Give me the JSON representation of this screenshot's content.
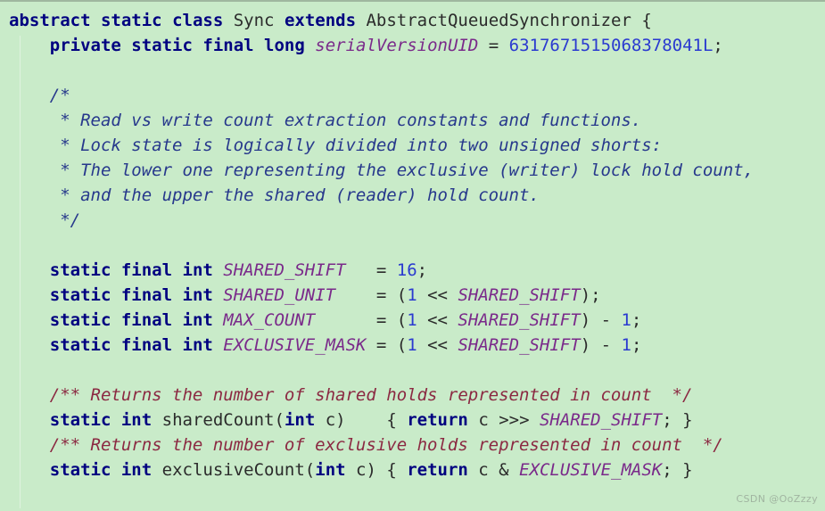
{
  "editor": {
    "language": "java",
    "background_color": "#c9ebc9",
    "top_border_color": "#9fb79f",
    "indent_guide_color": "#dff2df",
    "theme_colors": {
      "keyword": "#000080",
      "identifier": "#2b2b2b",
      "constant": "#7a2a8a",
      "number": "#2a3ad0",
      "block_comment": "#27388c",
      "javadoc_comment": "#8b2942"
    }
  },
  "watermark": {
    "text": "CSDN @OoZzzy"
  },
  "lines": [
    {
      "id": 1,
      "tokens": [
        {
          "t": "abstract",
          "k": "kw"
        },
        {
          "t": " ",
          "k": "punc"
        },
        {
          "t": "static",
          "k": "kw"
        },
        {
          "t": " ",
          "k": "punc"
        },
        {
          "t": "class",
          "k": "kw"
        },
        {
          "t": " ",
          "k": "punc"
        },
        {
          "t": "Sync",
          "k": "type"
        },
        {
          "t": " ",
          "k": "punc"
        },
        {
          "t": "extends",
          "k": "kw"
        },
        {
          "t": " ",
          "k": "punc"
        },
        {
          "t": "AbstractQueuedSynchronizer",
          "k": "type"
        },
        {
          "t": " {",
          "k": "punc"
        }
      ]
    },
    {
      "id": 2,
      "tokens": [
        {
          "t": "    ",
          "k": "punc"
        },
        {
          "t": "private",
          "k": "kw"
        },
        {
          "t": " ",
          "k": "punc"
        },
        {
          "t": "static",
          "k": "kw"
        },
        {
          "t": " ",
          "k": "punc"
        },
        {
          "t": "final",
          "k": "kw"
        },
        {
          "t": " ",
          "k": "punc"
        },
        {
          "t": "long",
          "k": "kw"
        },
        {
          "t": " ",
          "k": "punc"
        },
        {
          "t": "serialVersionUID",
          "k": "const"
        },
        {
          "t": " = ",
          "k": "op"
        },
        {
          "t": "6317671515068378041L",
          "k": "num"
        },
        {
          "t": ";",
          "k": "punc"
        }
      ]
    },
    {
      "id": 3,
      "tokens": []
    },
    {
      "id": 4,
      "tokens": [
        {
          "t": "    ",
          "k": "punc"
        },
        {
          "t": "/*",
          "k": "comment"
        }
      ]
    },
    {
      "id": 5,
      "tokens": [
        {
          "t": "    ",
          "k": "punc"
        },
        {
          "t": " * Read vs write count extraction constants and functions.",
          "k": "comment"
        }
      ]
    },
    {
      "id": 6,
      "tokens": [
        {
          "t": "    ",
          "k": "punc"
        },
        {
          "t": " * Lock state is logically divided into two unsigned shorts:",
          "k": "comment"
        }
      ]
    },
    {
      "id": 7,
      "tokens": [
        {
          "t": "    ",
          "k": "punc"
        },
        {
          "t": " * The lower one representing the exclusive (writer) lock hold count,",
          "k": "comment"
        }
      ]
    },
    {
      "id": 8,
      "tokens": [
        {
          "t": "    ",
          "k": "punc"
        },
        {
          "t": " * and the upper the shared (reader) hold count.",
          "k": "comment"
        }
      ]
    },
    {
      "id": 9,
      "tokens": [
        {
          "t": "    ",
          "k": "punc"
        },
        {
          "t": " */",
          "k": "comment"
        }
      ]
    },
    {
      "id": 10,
      "tokens": []
    },
    {
      "id": 11,
      "tokens": [
        {
          "t": "    ",
          "k": "punc"
        },
        {
          "t": "static",
          "k": "kw"
        },
        {
          "t": " ",
          "k": "punc"
        },
        {
          "t": "final",
          "k": "kw"
        },
        {
          "t": " ",
          "k": "punc"
        },
        {
          "t": "int",
          "k": "kw"
        },
        {
          "t": " ",
          "k": "punc"
        },
        {
          "t": "SHARED_SHIFT",
          "k": "const"
        },
        {
          "t": "   = ",
          "k": "op"
        },
        {
          "t": "16",
          "k": "num"
        },
        {
          "t": ";",
          "k": "punc"
        }
      ]
    },
    {
      "id": 12,
      "tokens": [
        {
          "t": "    ",
          "k": "punc"
        },
        {
          "t": "static",
          "k": "kw"
        },
        {
          "t": " ",
          "k": "punc"
        },
        {
          "t": "final",
          "k": "kw"
        },
        {
          "t": " ",
          "k": "punc"
        },
        {
          "t": "int",
          "k": "kw"
        },
        {
          "t": " ",
          "k": "punc"
        },
        {
          "t": "SHARED_UNIT",
          "k": "const"
        },
        {
          "t": "    = (",
          "k": "op"
        },
        {
          "t": "1",
          "k": "num"
        },
        {
          "t": " << ",
          "k": "op"
        },
        {
          "t": "SHARED_SHIFT",
          "k": "const"
        },
        {
          "t": ");",
          "k": "punc"
        }
      ]
    },
    {
      "id": 13,
      "tokens": [
        {
          "t": "    ",
          "k": "punc"
        },
        {
          "t": "static",
          "k": "kw"
        },
        {
          "t": " ",
          "k": "punc"
        },
        {
          "t": "final",
          "k": "kw"
        },
        {
          "t": " ",
          "k": "punc"
        },
        {
          "t": "int",
          "k": "kw"
        },
        {
          "t": " ",
          "k": "punc"
        },
        {
          "t": "MAX_COUNT",
          "k": "const"
        },
        {
          "t": "      = (",
          "k": "op"
        },
        {
          "t": "1",
          "k": "num"
        },
        {
          "t": " << ",
          "k": "op"
        },
        {
          "t": "SHARED_SHIFT",
          "k": "const"
        },
        {
          "t": ") - ",
          "k": "op"
        },
        {
          "t": "1",
          "k": "num"
        },
        {
          "t": ";",
          "k": "punc"
        }
      ]
    },
    {
      "id": 14,
      "tokens": [
        {
          "t": "    ",
          "k": "punc"
        },
        {
          "t": "static",
          "k": "kw"
        },
        {
          "t": " ",
          "k": "punc"
        },
        {
          "t": "final",
          "k": "kw"
        },
        {
          "t": " ",
          "k": "punc"
        },
        {
          "t": "int",
          "k": "kw"
        },
        {
          "t": " ",
          "k": "punc"
        },
        {
          "t": "EXCLUSIVE_MASK",
          "k": "const"
        },
        {
          "t": " = (",
          "k": "op"
        },
        {
          "t": "1",
          "k": "num"
        },
        {
          "t": " << ",
          "k": "op"
        },
        {
          "t": "SHARED_SHIFT",
          "k": "const"
        },
        {
          "t": ") - ",
          "k": "op"
        },
        {
          "t": "1",
          "k": "num"
        },
        {
          "t": ";",
          "k": "punc"
        }
      ]
    },
    {
      "id": 15,
      "tokens": []
    },
    {
      "id": 16,
      "tokens": [
        {
          "t": "    ",
          "k": "punc"
        },
        {
          "t": "/** Returns the number of shared holds represented in count  */",
          "k": "doc"
        }
      ]
    },
    {
      "id": 17,
      "tokens": [
        {
          "t": "    ",
          "k": "punc"
        },
        {
          "t": "static",
          "k": "kw"
        },
        {
          "t": " ",
          "k": "punc"
        },
        {
          "t": "int",
          "k": "kw"
        },
        {
          "t": " ",
          "k": "punc"
        },
        {
          "t": "sharedCount",
          "k": "id"
        },
        {
          "t": "(",
          "k": "punc"
        },
        {
          "t": "int",
          "k": "kw"
        },
        {
          "t": " c)",
          "k": "punc"
        },
        {
          "t": "    { ",
          "k": "punc"
        },
        {
          "t": "return",
          "k": "kw"
        },
        {
          "t": " c >>> ",
          "k": "op"
        },
        {
          "t": "SHARED_SHIFT",
          "k": "const"
        },
        {
          "t": "; }",
          "k": "punc"
        }
      ]
    },
    {
      "id": 18,
      "tokens": [
        {
          "t": "    ",
          "k": "punc"
        },
        {
          "t": "/** Returns the number of exclusive holds represented in count  */",
          "k": "doc"
        }
      ]
    },
    {
      "id": 19,
      "tokens": [
        {
          "t": "    ",
          "k": "punc"
        },
        {
          "t": "static",
          "k": "kw"
        },
        {
          "t": " ",
          "k": "punc"
        },
        {
          "t": "int",
          "k": "kw"
        },
        {
          "t": " ",
          "k": "punc"
        },
        {
          "t": "exclusiveCount",
          "k": "id"
        },
        {
          "t": "(",
          "k": "punc"
        },
        {
          "t": "int",
          "k": "kw"
        },
        {
          "t": " c) { ",
          "k": "punc"
        },
        {
          "t": "return",
          "k": "kw"
        },
        {
          "t": " c & ",
          "k": "op"
        },
        {
          "t": "EXCLUSIVE_MASK",
          "k": "const"
        },
        {
          "t": "; }",
          "k": "punc"
        }
      ]
    }
  ]
}
